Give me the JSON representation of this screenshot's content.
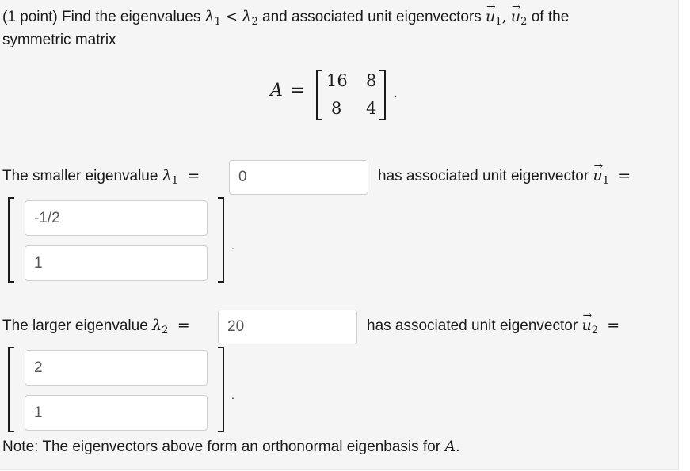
{
  "question": {
    "points_label": "(1 point) Find the eigenvalues",
    "lambda_symbol": "λ",
    "lambda1_sub": "1",
    "lambda2_sub": "2",
    "less_than": "<",
    "mid_text": "and associated unit eigenvectors",
    "u_symbol": "u",
    "comma": ",",
    "end_text": "of the",
    "line2": "symmetric matrix"
  },
  "matrix": {
    "name": "A",
    "equals": "=",
    "rows": [
      [
        "16",
        "8"
      ],
      [
        "8",
        "4"
      ]
    ],
    "period": "."
  },
  "smaller": {
    "label": "The smaller eigenvalue",
    "eq": "=",
    "value": "0",
    "assoc_text": "has associated unit eigenvector",
    "vec_sub": "1",
    "vec_eq": "=",
    "components": [
      "-1/2",
      "1"
    ],
    "period": "."
  },
  "larger": {
    "label": "The larger eigenvalue",
    "eq": "=",
    "value": "20",
    "assoc_text": "has associated unit eigenvector",
    "vec_sub": "2",
    "vec_eq": "=",
    "components": [
      "2",
      "1"
    ],
    "period": "."
  },
  "note": {
    "text": "Note: The eigenvectors above form an orthonormal eigenbasis for",
    "matrix_name": "A",
    "period": "."
  }
}
